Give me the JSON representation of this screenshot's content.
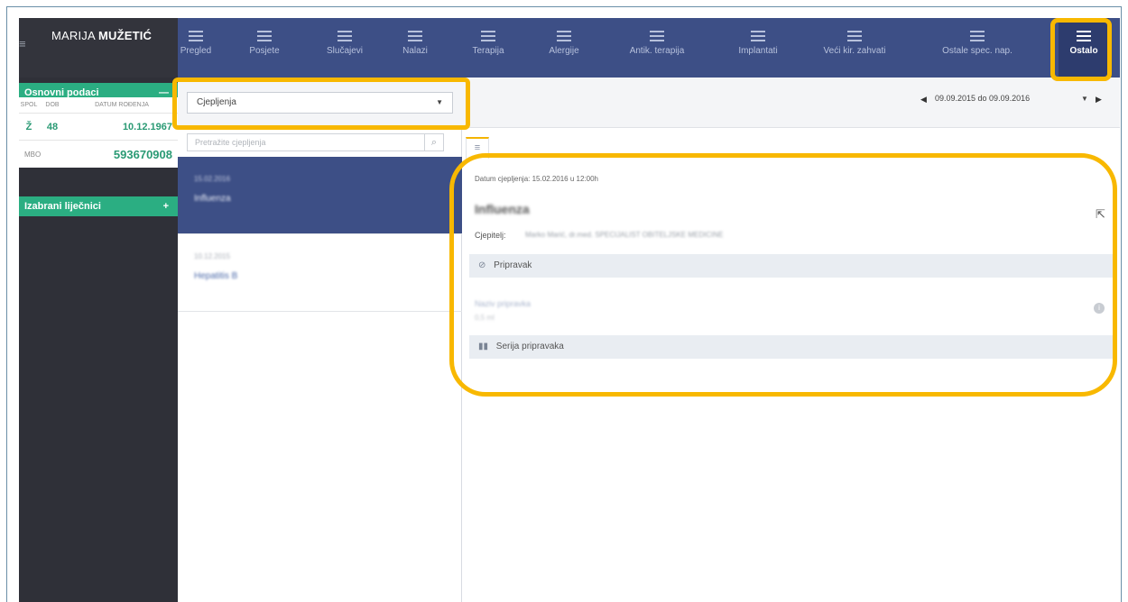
{
  "patient": {
    "first_name": "MARIJA",
    "last_name": "MUŽETIĆ"
  },
  "sidebar": {
    "basic_section": {
      "label": "Osnovni podaci",
      "toggle": "—"
    },
    "table": {
      "headers": [
        "SPOL",
        "DOB",
        "DATUM ROĐENJA"
      ],
      "values": [
        "Ž",
        "48",
        "10.12.1967"
      ]
    },
    "mbo": {
      "label": "MBO",
      "value": "593670908"
    },
    "doctors_section": {
      "label": "Izabrani liječnici",
      "toggle": "+"
    }
  },
  "nav": {
    "items": [
      {
        "label": "Pregled"
      },
      {
        "label": "Posjete"
      },
      {
        "label": "Slučajevi"
      },
      {
        "label": "Nalazi"
      },
      {
        "label": "Terapija"
      },
      {
        "label": "Alergije"
      },
      {
        "label": "Antik. terapija"
      },
      {
        "label": "Implantati"
      },
      {
        "label": "Veći kir. zahvati"
      },
      {
        "label": "Ostale spec. nap."
      },
      {
        "label": "Ostalo"
      }
    ],
    "active": "Ostalo"
  },
  "list": {
    "category_select": "Cjepljenja",
    "search_placeholder": "Pretražite cjepljenja",
    "items": [
      {
        "date": "15.02.2016",
        "name": "Influenza"
      },
      {
        "date": "10.12.2015",
        "name": "Hepatitis B"
      }
    ]
  },
  "detail": {
    "date_range": "09.09.2015 do 09.09.2016",
    "date_label": "Datum cjepljenja: 15.02.2016 u 12:00h",
    "title": "Influenza",
    "vaccinated_by_label": "Cjepitelj:",
    "vaccinated_by_value": "Marko Marić, dr.med. SPECIJALIST OBITELJSKE MEDICINE",
    "preparation_section": "Pripravak",
    "preparation_name": "Naziv pripravka",
    "preparation_sub": "0,5 ml",
    "series_section": "Serija pripravaka"
  },
  "colors": {
    "nav_bg": "#3d4f86",
    "accent_green": "#2bae82",
    "highlight": "#f8b800",
    "sidebar_bg": "#2f3038"
  }
}
